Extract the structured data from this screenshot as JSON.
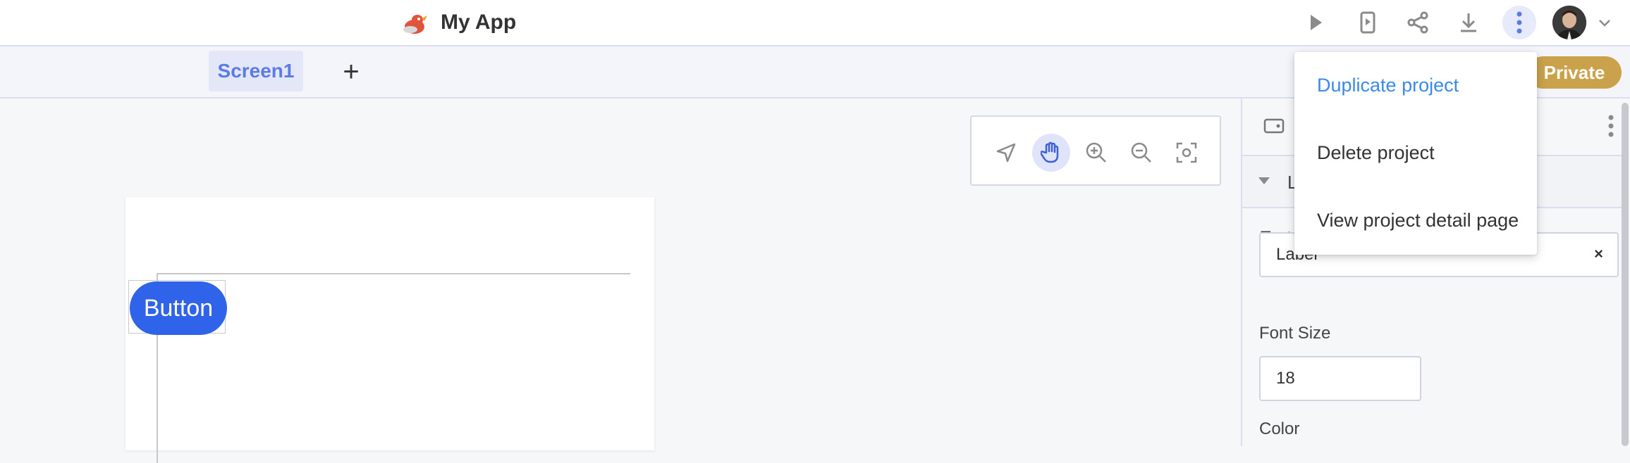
{
  "header": {
    "app_title": "My App",
    "icons": [
      "play-icon",
      "phone-preview-icon",
      "share-icon",
      "download-icon",
      "more-vertical-icon"
    ]
  },
  "tabs": {
    "screens": [
      {
        "label": "Screen1"
      }
    ],
    "add_label": "+",
    "visibility_badge": "Private"
  },
  "canvas_tools": [
    "select-icon",
    "hand-icon",
    "zoom-in-icon",
    "zoom-out-icon",
    "fit-screen-icon"
  ],
  "preview": {
    "button_label": "Button"
  },
  "properties": {
    "section_label": "L",
    "text_label": "Text",
    "text_value": "Label",
    "clear_label": "×",
    "font_size_label": "Font Size",
    "font_size_value": "18",
    "color_label": "Color"
  },
  "menu": {
    "items": [
      {
        "label": "Duplicate project"
      },
      {
        "label": "Delete project"
      },
      {
        "label": "View project detail page"
      }
    ]
  },
  "colors": {
    "accent": "#2f63ea",
    "tab_text": "#5b7be6",
    "menu_highlight": "#3a8be8",
    "private_badge": "#c9a24b"
  }
}
